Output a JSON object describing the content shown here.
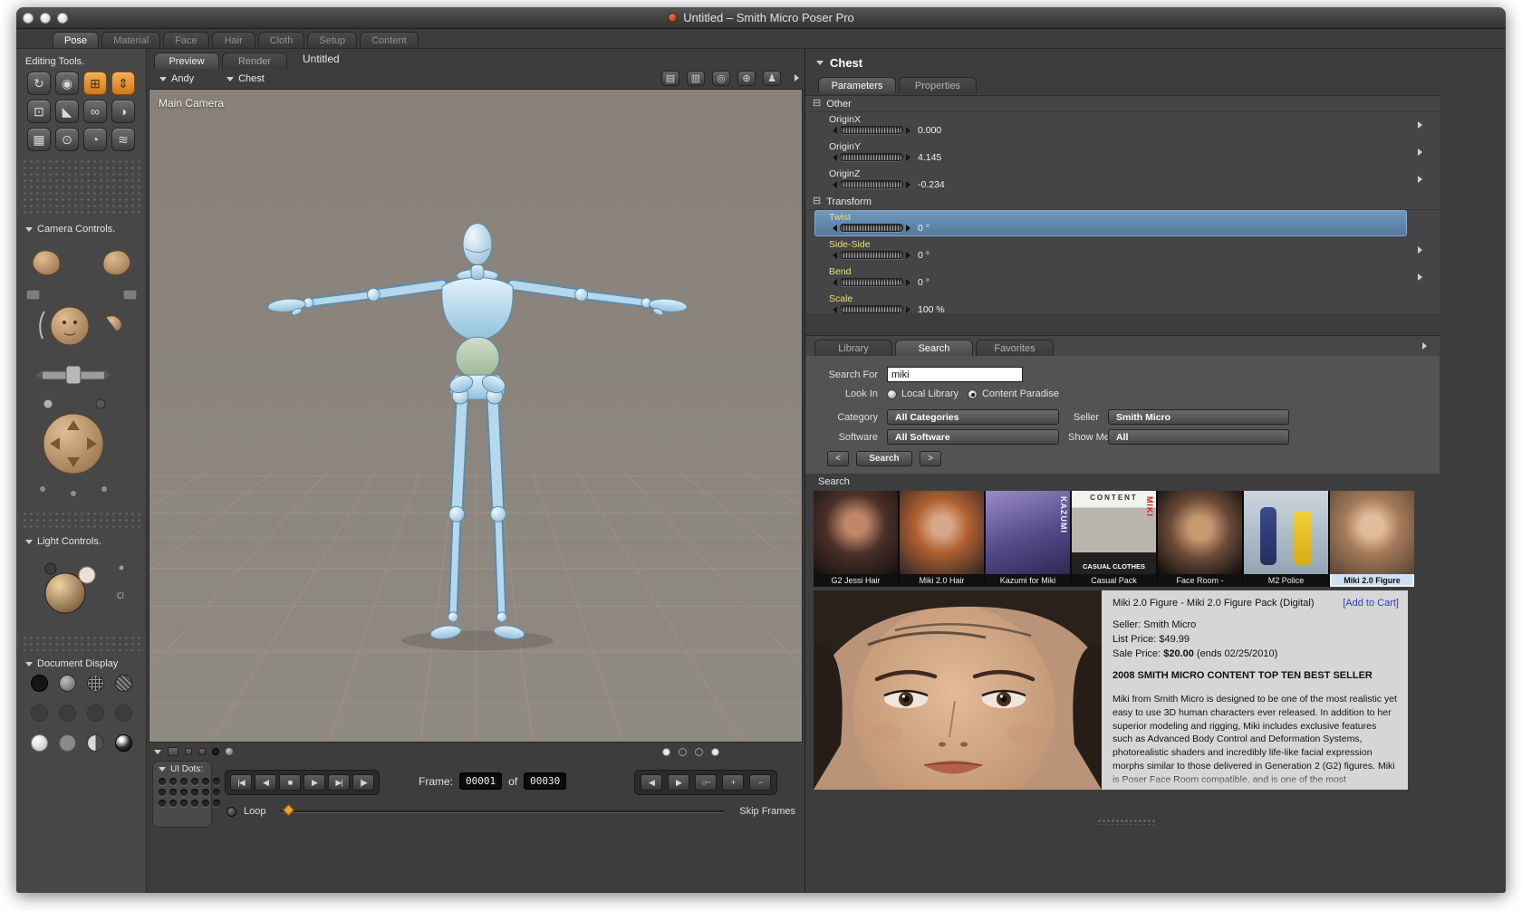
{
  "window": {
    "title": "Untitled – Smith Micro Poser Pro"
  },
  "app_tabs": [
    {
      "label": "Pose"
    },
    {
      "label": "Material"
    },
    {
      "label": "Face"
    },
    {
      "label": "Hair"
    },
    {
      "label": "Cloth"
    },
    {
      "label": "Setup"
    },
    {
      "label": "Content"
    }
  ],
  "sidebar": {
    "editing_tools_label": "Editing Tools.",
    "tools": [
      {
        "name": "rotate",
        "glyph": "↻"
      },
      {
        "name": "twist",
        "glyph": "◉"
      },
      {
        "name": "translate",
        "glyph": "⊞"
      },
      {
        "name": "translate-in-out",
        "glyph": "⇕"
      },
      {
        "name": "scale",
        "glyph": "⊡"
      },
      {
        "name": "taper",
        "glyph": "◣"
      },
      {
        "name": "chain-break",
        "glyph": "∞"
      },
      {
        "name": "color",
        "glyph": "◑"
      },
      {
        "name": "grouping",
        "glyph": "▦"
      },
      {
        "name": "view-magnifier",
        "glyph": "⊙"
      },
      {
        "name": "morphing-tool",
        "glyph": "◔"
      },
      {
        "name": "wave",
        "glyph": "≋"
      }
    ],
    "camera_controls_label": "Camera Controls.",
    "light_controls_label": "Light Controls.",
    "document_display_label": "Document Display"
  },
  "viewport": {
    "tab_preview": "Preview",
    "tab_render": "Render",
    "doc_title": "Untitled",
    "figure_menu": "Andy",
    "actor_menu": "Chest",
    "camera_name": "Main Camera",
    "header_icons": [
      {
        "name": "camera-flyout-icon",
        "glyph": "▤"
      },
      {
        "name": "display-style-icon",
        "glyph": "▥"
      },
      {
        "name": "trackball-icon",
        "glyph": "◎"
      },
      {
        "name": "axes-icon",
        "glyph": "⊕"
      },
      {
        "name": "figure-visibility-icon",
        "glyph": "♟"
      }
    ]
  },
  "transport": {
    "ui_dots_label": "UI Dots:",
    "buttons": [
      {
        "name": "first-frame",
        "glyph": "|◀"
      },
      {
        "name": "prev-frame",
        "glyph": "◀"
      },
      {
        "name": "stop",
        "glyph": "■"
      },
      {
        "name": "play",
        "glyph": "▶"
      },
      {
        "name": "next-frame",
        "glyph": "▶|"
      },
      {
        "name": "last-frame",
        "glyph": "|▶"
      }
    ],
    "right_buttons": [
      {
        "name": "step-back",
        "glyph": "◀"
      },
      {
        "name": "step-forward",
        "glyph": "▶"
      },
      {
        "name": "edit-keyframes",
        "glyph": "○┄"
      },
      {
        "name": "add-keyframe",
        "glyph": "+"
      },
      {
        "name": "delete-keyframe",
        "glyph": "−"
      }
    ],
    "frame_label": "Frame:",
    "frame_current": "00001",
    "of_label": "of",
    "frame_total": "00030",
    "loop_label": "Loop",
    "skip_frames_label": "Skip Frames"
  },
  "parameters": {
    "actor_title": "Chest",
    "tab_parameters": "Parameters",
    "tab_properties": "Properties",
    "group_other": "Other",
    "group_transform": "Transform",
    "rows": [
      {
        "label": "OriginX",
        "value": "0.000"
      },
      {
        "label": "OriginY",
        "value": "4.145"
      },
      {
        "label": "OriginZ",
        "value": "-0.234"
      },
      {
        "label": "Twist",
        "value": "0 °"
      },
      {
        "label": "Side-Side",
        "value": "0 °"
      },
      {
        "label": "Bend",
        "value": "0 °"
      },
      {
        "label": "Scale",
        "value": "100 %"
      }
    ]
  },
  "library": {
    "tab_library": "Library",
    "tab_search": "Search",
    "tab_favorites": "Favorites",
    "search_for_label": "Search For",
    "search_value": "miki",
    "look_in_label": "Look In",
    "option_local_library": "Local Library",
    "option_content_paradise": "Content Paradise",
    "category_label": "Category",
    "category_value": "All Categories",
    "seller_label": "Seller",
    "seller_value": "Smith Micro",
    "software_label": "Software",
    "software_value": "All Software",
    "show_me_label": "Show Me",
    "show_me_value": "All",
    "prev_page_label": "<",
    "search_button_label": "Search",
    "next_page_label": ">",
    "results_header": "Search"
  },
  "results": {
    "thumbnails": [
      {
        "label": "G2 Jessi Hair"
      },
      {
        "label": "Miki 2.0 Hair"
      },
      {
        "label": "Kazumi for Miki",
        "overlay_side": "KAZUMI"
      },
      {
        "label": "Casual Pack",
        "overlay_top": "CONTENT",
        "overlay_mid": "CASUAL CLOTHES",
        "overlay_side": "MIKI"
      },
      {
        "label": "Face Room -"
      },
      {
        "label": "M2 Police"
      },
      {
        "label": "Miki 2.0 Figure"
      }
    ]
  },
  "product": {
    "title": "Miki 2.0 Figure - Miki 2.0 Figure Pack (Digital)",
    "add_to_cart_label": "[Add to Cart]",
    "seller_line": "Seller: Smith Micro",
    "list_price_line": "List Price: $49.99",
    "sale_price_label": "Sale Price: ",
    "sale_price_value": "$20.00",
    "sale_price_suffix": " (ends 02/25/2010)",
    "best_seller_line": "2008 SMITH MICRO CONTENT TOP TEN BEST SELLER",
    "description": "Miki from Smith Micro is designed to be one of the most realistic yet easy to use 3D human characters ever released. In addition to her superior modeling and rigging, Miki includes exclusive features such as Advanced Body Control and Deformation Systems, photorealistic shaders and incredibly life-like facial expression morphs similar to those delivered in Generation 2 (G2) figures. Miki is Poser Face Room compatible, and is one of the most"
  },
  "colors": {
    "highlight_row_blue": "#5e85ad",
    "param_label_yellow": "#e6e07a",
    "selection_blue": "#cfe0f2",
    "add_to_cart_link": "#2a3fd4",
    "tool_orange": "#e89b3c",
    "loop_marker_orange": "#f0a030",
    "viewport_background": "#8c8781",
    "figure_blue": "#a9cfe4"
  }
}
